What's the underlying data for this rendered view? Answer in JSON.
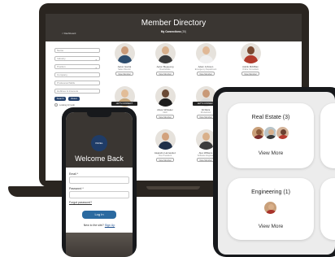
{
  "laptop": {
    "directory": {
      "title": "Member Directory",
      "subtitle_bold": "My Connections",
      "subtitle_count": "(35)",
      "back_link": "< Dashboard",
      "sidebar": {
        "fields": [
          {
            "placeholder": "Name",
            "dropdown": false
          },
          {
            "placeholder": "Industry",
            "dropdown": true
          },
          {
            "placeholder": "Position",
            "dropdown": true
          },
          {
            "placeholder": "Company",
            "dropdown": false
          },
          {
            "placeholder": "Profession/Skills",
            "dropdown": false
          },
          {
            "placeholder": "Hobbies & Interests",
            "dropdown": false
          }
        ],
        "search_label": "Search",
        "reset_label": "Reset",
        "checkbox_label": "Looking for Help"
      },
      "members": [
        {
          "name": "Aaron Garcia",
          "role": "Sales Director",
          "tag": "",
          "view": "View Member",
          "skin": "#c99a78",
          "shirt": "#2d4d6e"
        },
        {
          "name": "Aaron Bugayong",
          "role": "Real Estate",
          "tag": "",
          "view": "View Member",
          "skin": "#d8b08c",
          "shirt": "#3a3a3a"
        },
        {
          "name": "Adam Johnson",
          "role": "Emergency Department",
          "tag": "",
          "view": "View Member",
          "skin": "#e0b896",
          "shirt": "#f0f0f0"
        },
        {
          "name": "Adolfo McMillan",
          "role": "Online Consultant",
          "tag": "",
          "view": "View Member",
          "skin": "#7a4a32",
          "shirt": "#b23b2c"
        },
        {
          "name": "Alexa Mihaylova",
          "role": "Marketing",
          "tag": "LET'S CONNECT",
          "view": "View Member",
          "skin": "#e2bd98",
          "shirt": "#c8a77a"
        },
        {
          "name": "Alison Whitaker",
          "role": "CEO",
          "tag": "",
          "view": "View Member",
          "skin": "#6a4a35",
          "shirt": "#1c1c1c"
        },
        {
          "name": "Ali Raza",
          "role": "IFA Advisor",
          "tag": "LET'S CONNECT",
          "view": "View Member",
          "skin": "#c99a78",
          "shirt": "#d9d9d9"
        },
        {
          "name": "Alejandro Hernandez",
          "role": "Vice President",
          "tag": "",
          "view": "View Member",
          "skin": "#d2a27d",
          "shirt": "#1f2f48"
        },
        {
          "name": "Alex Williams",
          "role": "Software Engineer",
          "tag": "",
          "view": "View Member",
          "skin": "#d9b08a",
          "shirt": "#3c3c3c"
        }
      ]
    }
  },
  "phone": {
    "logo_text": "PAVEL",
    "welcome": "Welcome Back",
    "email_label": "Email *",
    "email_hint": "Email",
    "password_label": "Password *",
    "forgot_label": "Forgot password?",
    "login_label": "Log In",
    "new_text": "New to the site?",
    "signup_label": "Sign Up"
  },
  "tablet": {
    "cards": [
      {
        "title": "Real Estate (3)",
        "more": "View More"
      },
      {
        "title": "Engineering (1)",
        "more": "View More"
      }
    ]
  }
}
